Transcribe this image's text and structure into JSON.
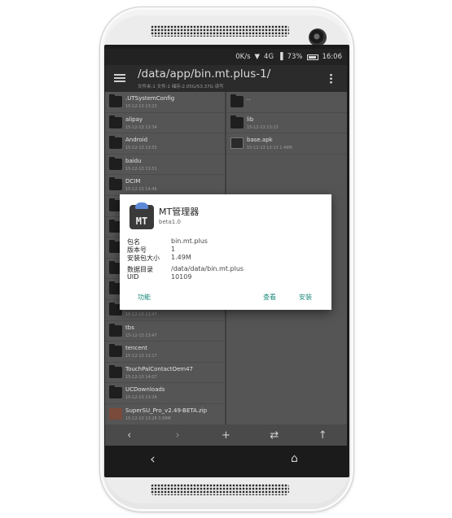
{
  "statusbar": {
    "speed": "0K/s",
    "wifi_icon": "wifi-icon",
    "signal_label": "4G",
    "battery": "73%",
    "time": "16:06"
  },
  "toolbar": {
    "path": "/data/app/bin.mt.plus-1/",
    "subtitle": "文件夹:1 文件:1  储存:2.05G/53.37G  读写",
    "menu_icon": "hamburger-icon",
    "overflow_icon": "more-vert-icon"
  },
  "left_files": [
    {
      "name": ".UTSystemConfig",
      "date": "15-12-13 13:23",
      "type": "folder"
    },
    {
      "name": "alipay",
      "date": "15-12-13 13:34",
      "type": "folder"
    },
    {
      "name": "Android",
      "date": "15-12-13 13:55",
      "type": "folder"
    },
    {
      "name": "baidu",
      "date": "15-12-13 13:51",
      "type": "folder"
    },
    {
      "name": "DCIM",
      "date": "15-12-13 14:46",
      "type": "folder"
    },
    {
      "name": "",
      "date": "",
      "type": "folder"
    },
    {
      "name": "",
      "date": "",
      "type": "folder"
    },
    {
      "name": "",
      "date": "",
      "type": "folder"
    },
    {
      "name": "",
      "date": "",
      "type": "folder"
    },
    {
      "name": "",
      "date": "",
      "type": "folder"
    },
    {
      "name": "",
      "date": "15-12-13 13:47",
      "type": "folder"
    },
    {
      "name": "tbs",
      "date": "15-12-13 13:47",
      "type": "folder"
    },
    {
      "name": "tencent",
      "date": "15-12-13 13:17",
      "type": "folder"
    },
    {
      "name": "TouchPalContactOem47",
      "date": "15-12-13 14:07",
      "type": "folder"
    },
    {
      "name": "UCDownloads",
      "date": "15-12-13 13:24",
      "type": "folder"
    },
    {
      "name": "SuperSU_Pro_v2.49-BETA.zip",
      "date": "15-12-13 13:28  3.99M",
      "type": "zip"
    }
  ],
  "right_files": [
    {
      "name": "..",
      "date": "",
      "type": "folder"
    },
    {
      "name": "lib",
      "date": "15-12-13 13:13",
      "type": "folder"
    },
    {
      "name": "base.apk",
      "date": "15-12-13 13:13  1.49M",
      "type": "apk"
    }
  ],
  "bottombar": {
    "prev": "‹",
    "next": "›",
    "add": "+",
    "swap": "⇄",
    "up": "↑"
  },
  "navbar": {
    "back": "‹",
    "home": "⌂"
  },
  "dialog": {
    "app_name": "MT管理器",
    "version": "beta1.0",
    "icon_text": "MT",
    "fields": [
      {
        "key": "包名",
        "value": "bin.mt.plus"
      },
      {
        "key": "版本号",
        "value": "1"
      },
      {
        "key": "安装包大小",
        "value": "1.49M"
      },
      {
        "key": "数据目录",
        "value": "/data/data/bin.mt.plus"
      },
      {
        "key": "UID",
        "value": "10109"
      }
    ],
    "actions": {
      "function": "功能",
      "view": "查看",
      "install": "安装"
    },
    "accent": "#1c8a7a"
  }
}
